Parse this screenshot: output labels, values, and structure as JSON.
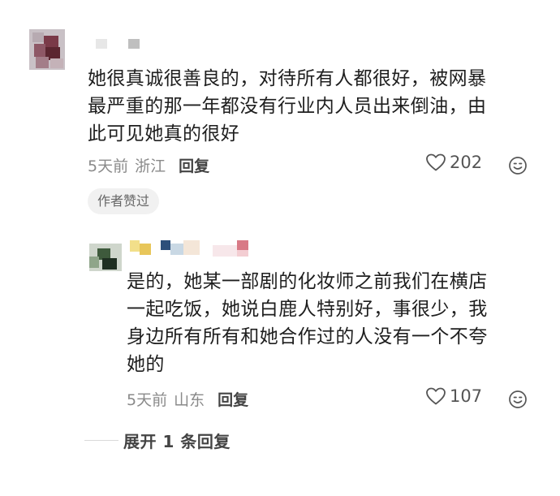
{
  "comments": [
    {
      "text_line1": "她很真诚很善良的，对待所有人都很好，被网暴",
      "text_line2": "最严重的那一年都没有行业内人员出来倒油，由",
      "text_line3": "此可见她真的很好",
      "time": "5天前",
      "location": "浙江",
      "reply_label": "回复",
      "likes": "202",
      "badge": "作者赞过"
    },
    {
      "text_line1": "是的，她某一部剧的化妆师之前我们在横店",
      "text_line2": "一起吃饭，她说白鹿人特别好，事很少，我",
      "text_line3": "身边所有所有和她合作过的人没有一个不夸",
      "text_line4": "她的",
      "time": "5天前",
      "location": "山东",
      "reply_label": "回复",
      "likes": "107"
    }
  ],
  "expand_label": "展开 1 条回复",
  "icons": {
    "like": "heart-outline-icon",
    "react": "smiley-icon"
  },
  "colors": {
    "text": "#1e1e1e",
    "meta": "#8a8a8a",
    "badge_bg": "#f1f1f1"
  }
}
